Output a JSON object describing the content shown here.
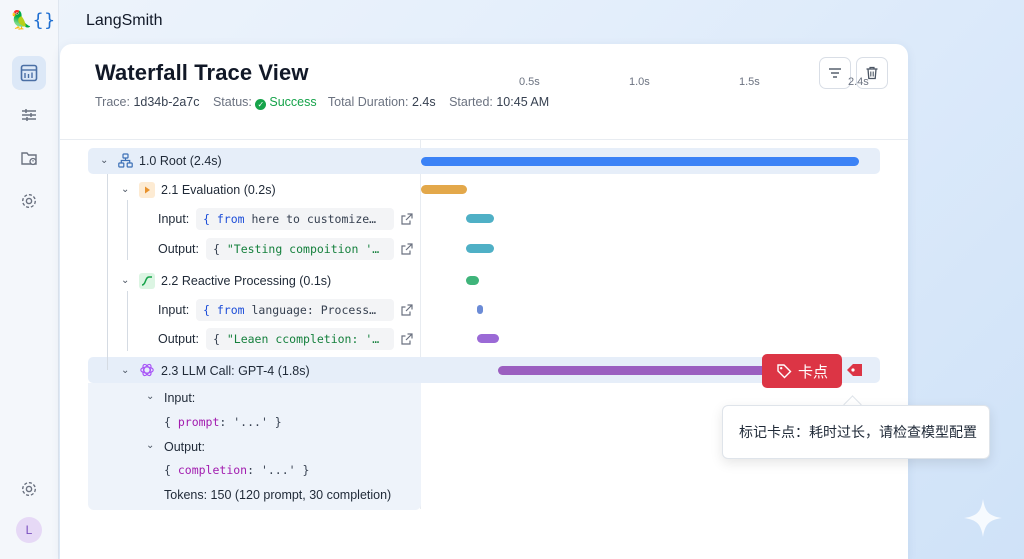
{
  "app": {
    "name": "LangSmith",
    "avatar_initial": "L"
  },
  "sidebar": {
    "items": [
      "dashboard-icon",
      "sliders-icon",
      "folder-clock-icon",
      "settings-icon"
    ],
    "bottom": [
      "settings-icon",
      "avatar"
    ]
  },
  "header": {
    "title": "Waterfall Trace View",
    "trace_label": "Trace:",
    "trace_id": "1d34b-2a7c",
    "status_label": "Status:",
    "status_value": "Success",
    "duration_label": "Total Duration:",
    "duration_value": "2.4s",
    "started_label": "Started:",
    "started_value": "10:45 AM",
    "tools": [
      "filter-icon",
      "trash-icon"
    ]
  },
  "timeline": {
    "ticks": [
      "0.5s",
      "1.0s",
      "1.5s",
      "2.4s"
    ]
  },
  "tree": {
    "root": {
      "label": "1.0 Root (2.4s)",
      "color": "#3b82f6",
      "start_s": 0.0,
      "duration_s": 2.4
    },
    "evaluation": {
      "label": "2.1 Evaluation (0.2s)",
      "input_label": "Input:",
      "input_kw": "{ from",
      "input_rest": " here to customize…",
      "output_label": "Output:",
      "output_open": "{ ",
      "output_str": "\"Testing compoition '…"
    },
    "reactive": {
      "label": "2.2 Reactive Processing (0.1s)",
      "input_label": "Input:",
      "input_kw": "{ from",
      "input_rest": " language: Process…",
      "output_label": "Output:",
      "output_open": "{ ",
      "output_str": "\"Leaen ccompletion: '…"
    },
    "llm": {
      "label": "2.3 LLM Call: GPT-4 (1.8s)",
      "input_label": "Input:",
      "prompt_open": "{ ",
      "prompt_key": "prompt",
      "prompt_val": ": '...' }",
      "output_label": "Output:",
      "completion_open": "{ ",
      "completion_key": "completion",
      "completion_val": ": '...' }",
      "tokens": "Tokens: 150 (120 prompt, 30 completion)"
    }
  },
  "marker": {
    "tag_text": "卡点",
    "tooltip": "标记卡点：耗时过长，请检查模型配置",
    "color": "#dc3545"
  }
}
